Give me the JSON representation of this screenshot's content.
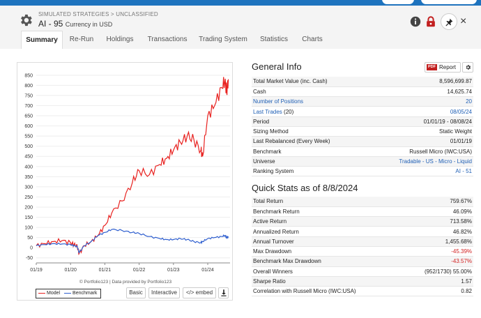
{
  "header": {
    "breadcrumb": "SIMULATED STRATEGIES > UNCLASSIFIED",
    "title": "AI - 95",
    "currency": "Currency in USD"
  },
  "tabs": [
    "Summary",
    "Re-Run",
    "Holdings",
    "Transactions",
    "Trading System",
    "Statistics",
    "Charts"
  ],
  "chart": {
    "credit": "© Portfolio123 | Data provided by Portfolio123",
    "buttons": {
      "basic": "Basic",
      "interactive": "Interactive",
      "embed": "</> embed"
    }
  },
  "chart_data": {
    "type": "line",
    "xticks": [
      "01/19",
      "01/20",
      "01/21",
      "01/22",
      "01/23",
      "01/24"
    ],
    "yticks": [
      -50,
      0,
      50,
      100,
      150,
      200,
      250,
      300,
      350,
      400,
      450,
      500,
      550,
      600,
      650,
      700,
      750,
      800,
      850
    ],
    "ylim": [
      -75,
      870
    ],
    "series": [
      {
        "name": "Model",
        "color": "#e8211f",
        "x": [
          2019.0,
          2019.25,
          2019.5,
          2019.75,
          2020.0,
          2020.1,
          2020.2,
          2020.25,
          2020.4,
          2020.6,
          2020.8,
          2021.0,
          2021.2,
          2021.5,
          2021.8,
          2022.0,
          2022.3,
          2022.6,
          2022.8,
          2023.0,
          2023.2,
          2023.4,
          2023.6,
          2023.8,
          2023.85,
          2024.0,
          2024.2,
          2024.4,
          2024.5,
          2024.55,
          2024.6
        ],
        "values": [
          10,
          20,
          30,
          35,
          25,
          15,
          5,
          -30,
          10,
          30,
          60,
          110,
          170,
          230,
          320,
          380,
          360,
          410,
          440,
          480,
          520,
          550,
          530,
          480,
          450,
          650,
          700,
          790,
          820,
          770,
          830
        ]
      },
      {
        "name": "Benchmark",
        "color": "#2f5fcf",
        "x": [
          2019.0,
          2019.25,
          2019.5,
          2019.75,
          2020.0,
          2020.1,
          2020.2,
          2020.25,
          2020.4,
          2020.6,
          2020.8,
          2021.0,
          2021.2,
          2021.5,
          2021.8,
          2022.0,
          2022.3,
          2022.6,
          2022.8,
          2023.0,
          2023.2,
          2023.4,
          2023.6,
          2023.8,
          2023.85,
          2024.0,
          2024.2,
          2024.4,
          2024.5,
          2024.55,
          2024.6
        ],
        "values": [
          10,
          15,
          20,
          18,
          15,
          10,
          5,
          -25,
          10,
          30,
          60,
          75,
          90,
          85,
          75,
          70,
          55,
          45,
          40,
          40,
          45,
          40,
          30,
          25,
          30,
          45,
          50,
          55,
          60,
          50,
          55
        ]
      }
    ]
  },
  "general": {
    "title": "General Info",
    "report_label": "Report",
    "pdf_label": "PDF",
    "rows": [
      {
        "label": "Total Market Value (inc. Cash)",
        "value": "8,596,699.87"
      },
      {
        "label": "Cash",
        "value": "14,625.74"
      },
      {
        "label": "Number of Positions",
        "value": "20",
        "link": true
      },
      {
        "label": "Last Trades",
        "label_suffix": " (20)",
        "value": "08/05/24",
        "link": true
      },
      {
        "label": "Period",
        "value": "01/01/19 - 08/08/24"
      },
      {
        "label": "Sizing Method",
        "value": "Static Weight"
      },
      {
        "label": "Last Rebalanced (Every Week)",
        "value": "01/01/19"
      },
      {
        "label": "Benchmark",
        "value": "Russell Micro (IWC:USA)"
      },
      {
        "label": "Universe",
        "value": "Tradable - US - Micro - Liquid",
        "value_link": true
      },
      {
        "label": "Ranking System",
        "value": "AI - 51",
        "value_link": true
      }
    ]
  },
  "quick": {
    "title": "Quick Stats as of 8/8/2024",
    "rows": [
      {
        "label": "Total Return",
        "value": "759.67%"
      },
      {
        "label": "Benchmark Return",
        "value": "46.09%"
      },
      {
        "label": "Active Return",
        "value": "713.58%"
      },
      {
        "label": "Annualized Return",
        "value": "46.82%"
      },
      {
        "label": "Annual Turnover",
        "value": "1,455.68%"
      },
      {
        "label": "Max Drawdown",
        "value": "-45.39%",
        "negative": true
      },
      {
        "label": "Benchmark Max Drawdown",
        "value": "-43.57%",
        "negative": true
      },
      {
        "label": "Overall Winners",
        "value": "(952/1730) 55.00%"
      },
      {
        "label": "Sharpe Ratio",
        "value": "1.57"
      },
      {
        "label": "Correlation with Russell Micro (IWC:USA)",
        "value": "0.82"
      }
    ]
  },
  "colors": {
    "accent": "#1e73be",
    "negative": "#d21f1f",
    "link": "#1f5fb5",
    "lock": "#c21f1f"
  }
}
